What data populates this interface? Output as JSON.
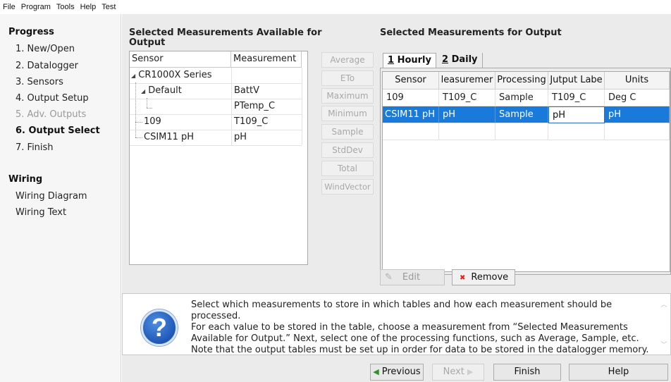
{
  "menubar": {
    "items": [
      "File",
      "Program",
      "Tools",
      "Help",
      "Test"
    ]
  },
  "sidebar": {
    "progress_heading": "Progress",
    "progress_items": [
      {
        "label": "1. New/Open",
        "state": "normal"
      },
      {
        "label": "2. Datalogger",
        "state": "normal"
      },
      {
        "label": "3. Sensors",
        "state": "normal"
      },
      {
        "label": "4. Output Setup",
        "state": "normal"
      },
      {
        "label": "5. Adv. Outputs",
        "state": "disabled"
      },
      {
        "label": "6. Output Select",
        "state": "active"
      },
      {
        "label": "7. Finish",
        "state": "normal"
      }
    ],
    "wiring_heading": "Wiring",
    "wiring_items": [
      {
        "label": "Wiring Diagram"
      },
      {
        "label": "Wiring Text"
      }
    ]
  },
  "available": {
    "title_line1": "Selected Measurements Available for",
    "title_line2": "Output",
    "headers": {
      "sensor": "Sensor",
      "measurement": "Measurement"
    },
    "rows": [
      {
        "sensor": "CR1000X Series",
        "measurement": ""
      },
      {
        "sensor": "Default",
        "measurement": "BattV"
      },
      {
        "sensor": "",
        "measurement": "PTemp_C"
      },
      {
        "sensor": "109",
        "measurement": "T109_C"
      },
      {
        "sensor": "CSIM11 pH",
        "measurement": "pH"
      }
    ]
  },
  "processing_buttons": [
    "Average",
    "ETo",
    "Maximum",
    "Minimum",
    "Sample",
    "StdDev",
    "Total",
    "WindVector"
  ],
  "output": {
    "title": "Selected Measurements for Output",
    "tabs": [
      {
        "key": "1",
        "rest": " Hourly"
      },
      {
        "key": "2",
        "rest": " Daily"
      }
    ],
    "headers": [
      "Sensor",
      "leasuremer",
      "Processing",
      "Jutput Labe",
      "Units"
    ],
    "rows": [
      [
        "109",
        "T109_C",
        "Sample",
        "T109_C",
        "Deg C"
      ],
      [
        "CSIM11 pH",
        "pH",
        "Sample",
        "pH",
        "pH"
      ]
    ],
    "selected_row": 1,
    "edit_button": "Edit",
    "remove_button": "Remove"
  },
  "help": {
    "lines": [
      "Select which measurements to store in which tables and how each measurement should be processed.",
      "For each value to be stored in the table, choose a measurement from “Selected Measurements",
      "Available for Output.” Next, select one of the processing functions, such as Average, Sample, etc.",
      "Note that the output tables must be set up in order for data to be stored in the datalogger memory."
    ]
  },
  "nav": {
    "previous": "Previous",
    "next": "Next",
    "finish": "Finish",
    "help": "Help"
  },
  "colors": {
    "selection": "#1a7ad9",
    "help_icon": "#1f57b8",
    "prev_arrow": "#2f8f2f"
  }
}
